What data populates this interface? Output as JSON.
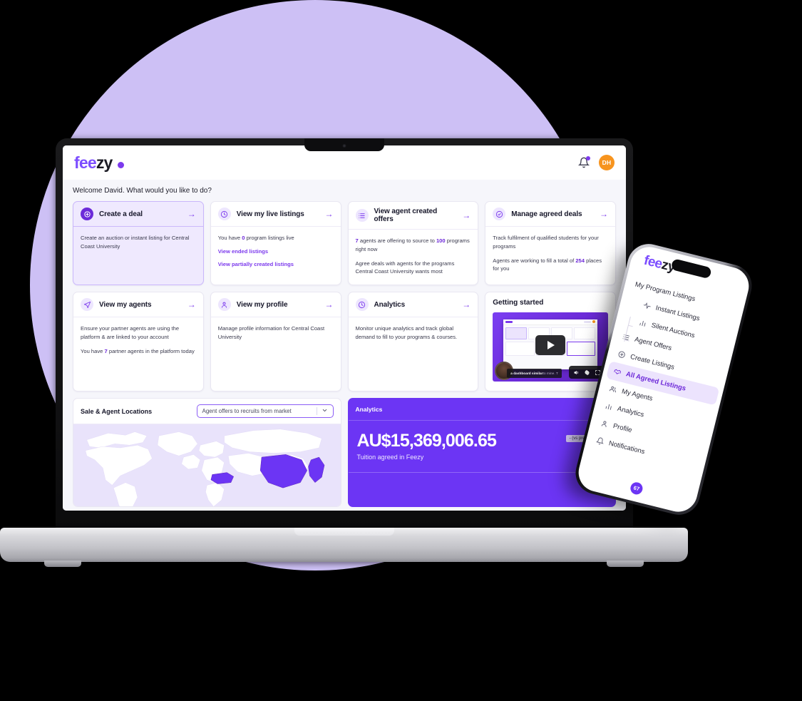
{
  "app": {
    "logo_purple": "fee",
    "logo_dark": "zy",
    "avatar_initials": "DH",
    "welcome": "Welcome David. What would you like to do?"
  },
  "cards": [
    {
      "id": "create-a-deal",
      "title": "Create a deal",
      "icon": "target-plus-icon",
      "arrow": "→",
      "accent": true,
      "lines": [
        "Create an auction or instant listing for Central Coast University"
      ]
    },
    {
      "id": "view-my-live-listings",
      "title": "View my live listings",
      "icon": "pie-clock-icon",
      "arrow": "→",
      "accent": false,
      "lead_pre": "You have ",
      "lead_num": "0",
      "lead_post": " program listings live",
      "links": [
        "View ended listings",
        "View partially created listings"
      ]
    },
    {
      "id": "view-agent-created-offers",
      "title": "View agent created offers",
      "icon": "list-icon",
      "arrow": "→",
      "accent": false,
      "l1_a": "7",
      "l1_b": " agents are offering to source to ",
      "l1_c": "100",
      "l1_d": " programs right now",
      "l2": "Agree deals with agents for the programs Central Coast University wants most"
    },
    {
      "id": "manage-agreed-deals",
      "title": "Manage agreed deals",
      "icon": "check-circle-icon",
      "arrow": "→",
      "accent": false,
      "l1": "Track fulfilment of qualified students for your programs",
      "l2_a": "Agents are working to fill a total of ",
      "l2_b": "254",
      "l2_c": " places for you"
    },
    {
      "id": "view-my-agents",
      "title": "View my agents",
      "icon": "send-icon",
      "arrow": "→",
      "accent": false,
      "l1": "Ensure your partner agents are using the platform & are linked to your account",
      "l2_a": "You have ",
      "l2_b": "7",
      "l2_c": " partner agents in the platform today"
    },
    {
      "id": "view-my-profile",
      "title": "View my profile",
      "icon": "person-icon",
      "arrow": "→",
      "accent": false,
      "l1": "Manage profile information for Central Coast University"
    },
    {
      "id": "analytics",
      "title": "Analytics",
      "icon": "pie-clock-icon",
      "arrow": "→",
      "accent": false,
      "l1": "Monitor unique analytics and track global demand to fill to your programs & courses."
    }
  ],
  "getting_started": {
    "title": "Getting started",
    "caption_bold": "a dashboard similar",
    "caption_rest": " to mine. T"
  },
  "map_panel": {
    "title": "Sale & Agent Locations",
    "select_value": "Agent offers to recruits from market",
    "chevron": "⌄"
  },
  "analytics_panel": {
    "title": "Analytics",
    "arrow": "→",
    "value": "AU$15,369,006.65",
    "subtitle": "Tuition agreed in Feezy",
    "tooltip": "- (vs previous we"
  },
  "phone": {
    "logo_purple": "fee",
    "logo_dark": "zy",
    "badge": "67",
    "menu": [
      {
        "label": "My Program Listings",
        "icon": "none",
        "sub": false,
        "active": false
      },
      {
        "label": "Instant Listings",
        "icon": "pulse-icon",
        "sub": true,
        "active": false
      },
      {
        "label": "Silent Auctions",
        "icon": "bars-icon",
        "sub": true,
        "active": false
      },
      {
        "label": "Agent Offers",
        "icon": "list-icon",
        "sub": false,
        "active": false
      },
      {
        "label": "Create Listings",
        "icon": "plus-circle-icon",
        "sub": false,
        "active": false
      },
      {
        "label": "All Agreed Listings",
        "icon": "handshake-icon",
        "sub": false,
        "active": true
      },
      {
        "label": "My Agents",
        "icon": "people-icon",
        "sub": false,
        "active": false
      },
      {
        "label": "Analytics",
        "icon": "bars-icon",
        "sub": false,
        "active": false
      },
      {
        "label": "Profile",
        "icon": "person-icon",
        "sub": false,
        "active": false
      },
      {
        "label": "Notifications",
        "icon": "bell-icon",
        "sub": false,
        "active": false
      }
    ]
  },
  "colors": {
    "brand_purple": "#7c3aed",
    "panel_purple": "#6c35f4",
    "backdrop": "#cdc0f5",
    "avatar_orange": "#f7941e",
    "card_accent_bg": "#efe9fe"
  }
}
